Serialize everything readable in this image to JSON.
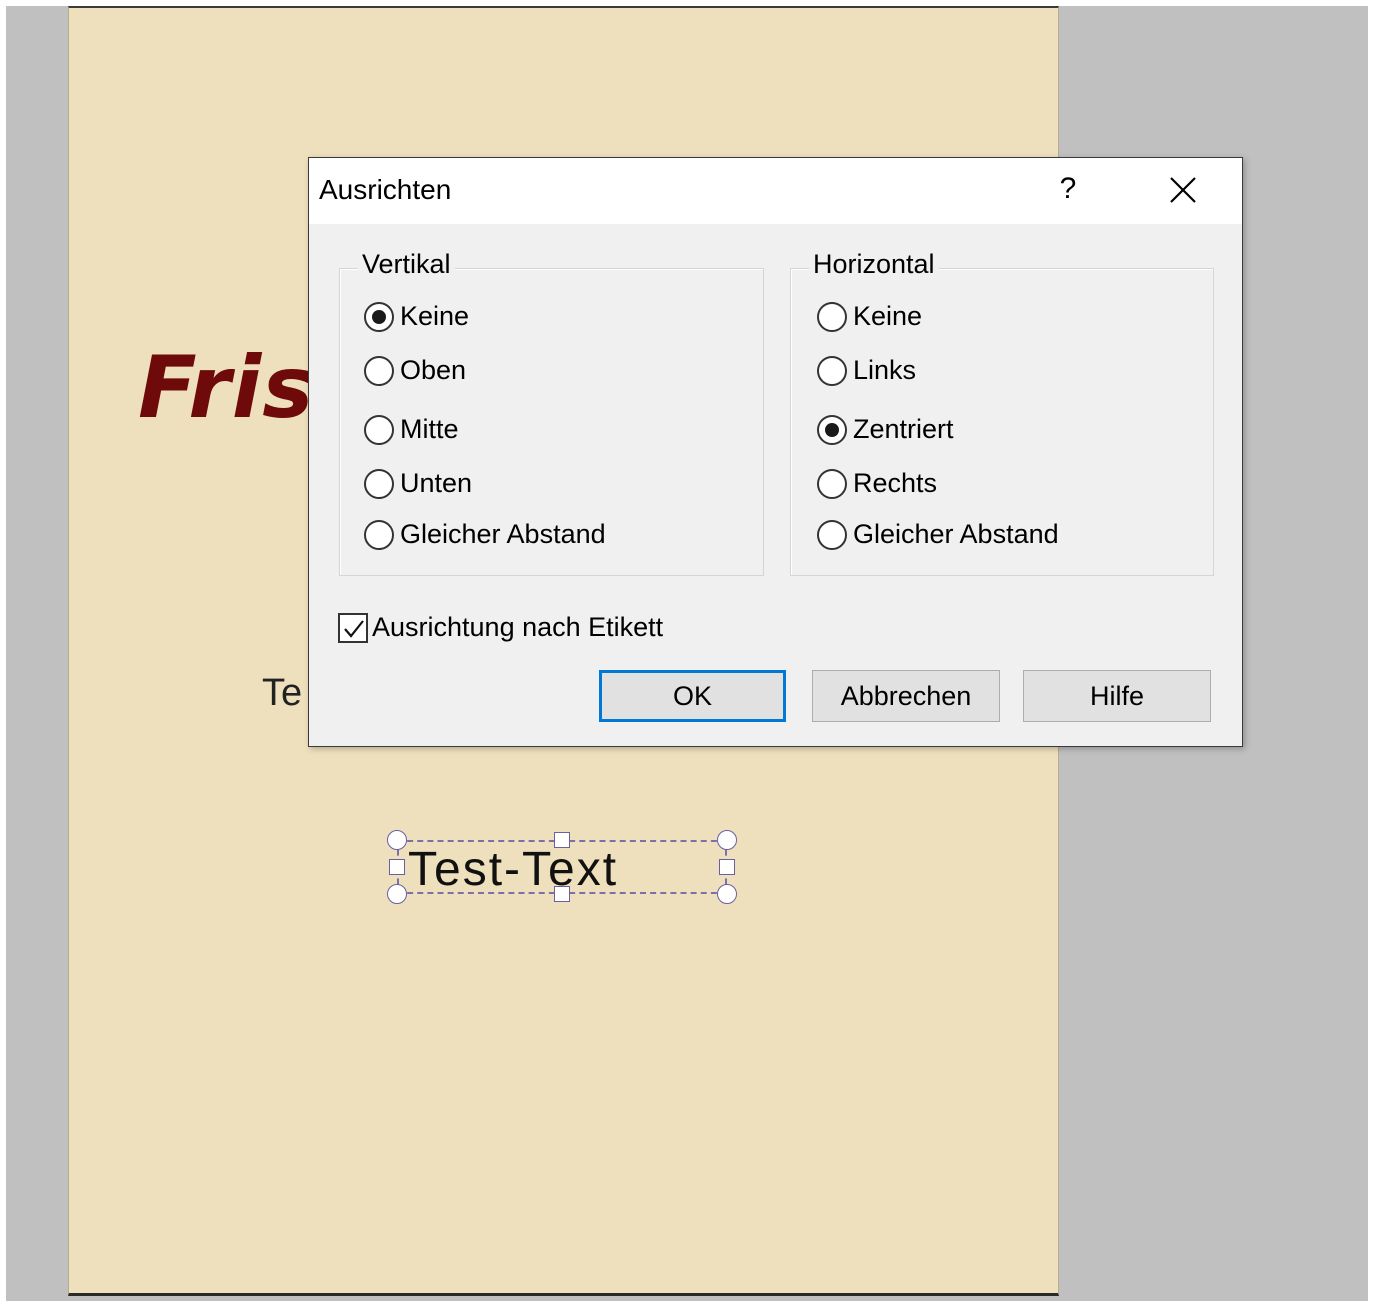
{
  "canvas": {
    "headline_text": "Fris",
    "subtext": "Te",
    "selected_text": "Test-Text"
  },
  "dialog": {
    "title": "Ausrichten",
    "help_symbol": "?",
    "close_symbol": "✕",
    "vertical": {
      "label": "Vertikal",
      "options": [
        "Keine",
        "Oben",
        "Mitte",
        "Unten",
        "Gleicher Abstand"
      ],
      "selected": "Keine"
    },
    "horizontal": {
      "label": "Horizontal",
      "options": [
        "Keine",
        "Links",
        "Zentriert",
        "Rechts",
        "Gleicher Abstand"
      ],
      "selected": "Zentriert"
    },
    "align_to_label": {
      "label": "Ausrichtung nach Etikett",
      "checked": true
    },
    "buttons": {
      "ok": "OK",
      "cancel": "Abbrechen",
      "help": "Hilfe"
    }
  },
  "colors": {
    "page": "#efe0bd",
    "workspace": "#c0c0c0",
    "headline": "#6e0a0a",
    "default_button_border": "#0078d7"
  }
}
